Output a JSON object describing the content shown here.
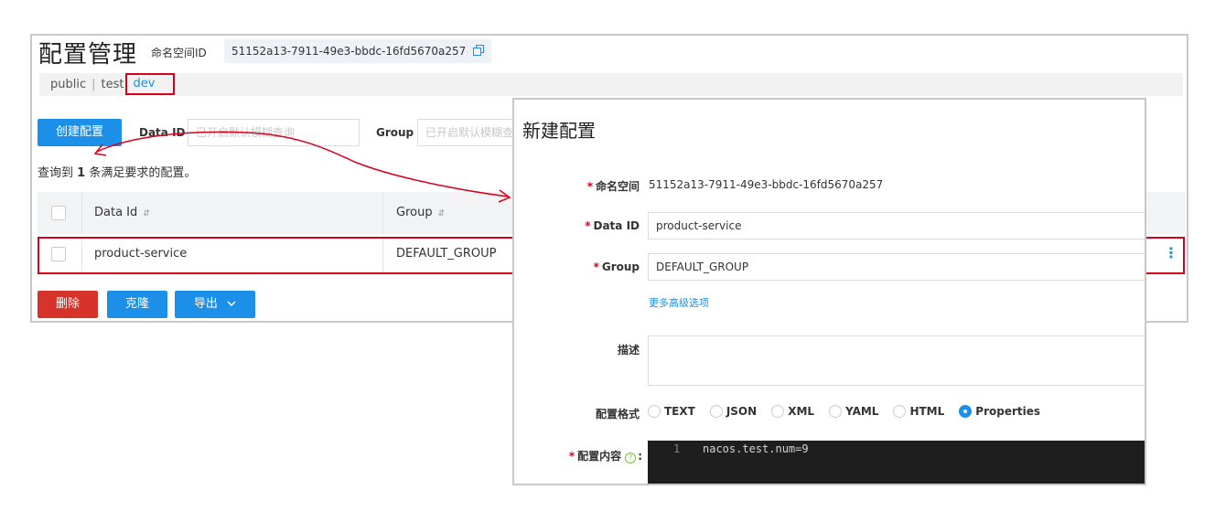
{
  "config_list": {
    "title": "配置管理",
    "namespace_label": "命名空间ID",
    "namespace_id": "51152a13-7911-49e3-bbdc-16fd5670a257",
    "namespace_tabs": [
      "public",
      "test",
      "dev"
    ],
    "namespace_separator": "|",
    "create_button": "创建配置",
    "data_id_label": "Data ID",
    "data_id_placeholder": "已开启默认模糊查询",
    "group_label": "Group",
    "group_placeholder": "已开启默认模糊查询",
    "result_prefix": "查询到",
    "result_count": "1",
    "result_suffix": "条满足要求的配置。",
    "columns": [
      "Data Id",
      "Group"
    ],
    "rows": [
      {
        "data_id": "product-service",
        "group": "DEFAULT_GROUP"
      }
    ],
    "delete_button": "删除",
    "clone_button": "克隆",
    "export_button": "导出"
  },
  "new_config": {
    "title": "新建配置",
    "namespace_label": "命名空间",
    "namespace_value": "51152a13-7911-49e3-bbdc-16fd5670a257",
    "data_id_label": "Data ID",
    "data_id_value": "product-service",
    "group_label": "Group",
    "group_value": "DEFAULT_GROUP",
    "advanced_link": "更多高级选项",
    "description_label": "描述",
    "format_label": "配置格式",
    "formats": [
      "TEXT",
      "JSON",
      "XML",
      "YAML",
      "HTML",
      "Properties"
    ],
    "selected_format": "Properties",
    "content_label": "配置内容",
    "content_colon": ":",
    "required_mark": "*",
    "editor_line_number": "1",
    "editor_line_text": "nacos.test.num=9"
  },
  "colors": {
    "accent": "#1c8fe8",
    "danger": "#d6332a",
    "highlight_box": "#d9001b",
    "editor_bg": "#1e1e1e"
  }
}
